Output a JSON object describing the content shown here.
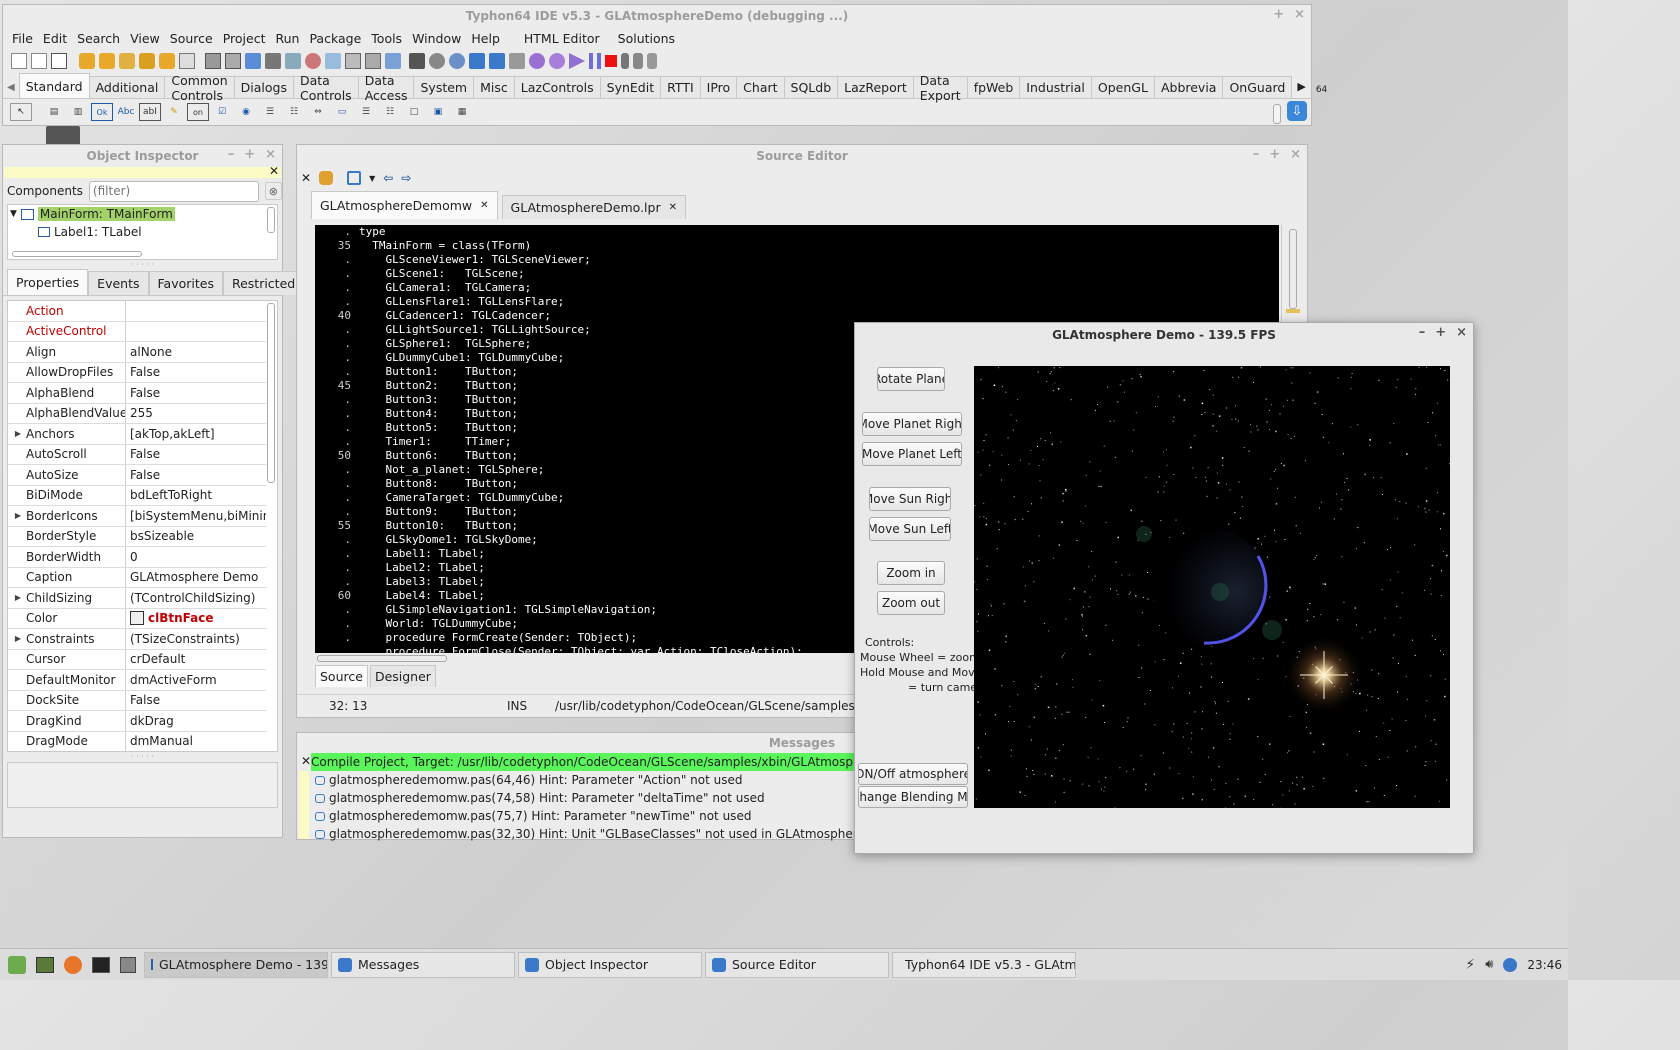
{
  "ide": {
    "title": "Typhon64 IDE v5.3 - GLAtmosphereDemo (debugging ...)",
    "menu": [
      "File",
      "Edit",
      "Search",
      "View",
      "Source",
      "Project",
      "Run",
      "Package",
      "Tools",
      "Window",
      "Help",
      "HTML Editor",
      "Solutions"
    ],
    "palette_tabs": [
      "Standard",
      "Additional",
      "Common Controls",
      "Dialogs",
      "Data Controls",
      "Data Access",
      "System",
      "Misc",
      "LazControls",
      "SynEdit",
      "RTTI",
      "IPro",
      "Chart",
      "SQLdb",
      "LazReport",
      "Data Export",
      "fpWeb",
      "Industrial",
      "OpenGL",
      "Abbrevia",
      "OnGuard"
    ],
    "bitness": "64",
    "component_glyphs": [
      "Ok",
      "Abc",
      "abI",
      "on"
    ]
  },
  "object_inspector": {
    "title": "Object Inspector",
    "components_label": "Components",
    "filter_placeholder": "(filter)",
    "tree": [
      "MainForm: TMainForm",
      "Label1: TLabel"
    ],
    "tabs": [
      "Properties",
      "Events",
      "Favorites",
      "Restricted"
    ],
    "properties": [
      {
        "name": "Action",
        "value": "",
        "highlight": true
      },
      {
        "name": "ActiveControl",
        "value": "",
        "highlight": true
      },
      {
        "name": "Align",
        "value": "alNone"
      },
      {
        "name": "AllowDropFiles",
        "value": "False"
      },
      {
        "name": "AlphaBlend",
        "value": "False"
      },
      {
        "name": "AlphaBlendValue",
        "value": "255"
      },
      {
        "name": "Anchors",
        "value": "[akTop,akLeft]",
        "expandable": true
      },
      {
        "name": "AutoScroll",
        "value": "False"
      },
      {
        "name": "AutoSize",
        "value": "False"
      },
      {
        "name": "BiDiMode",
        "value": "bdLeftToRight"
      },
      {
        "name": "BorderIcons",
        "value": "[biSystemMenu,biMinim",
        "expandable": true
      },
      {
        "name": "BorderStyle",
        "value": "bsSizeable"
      },
      {
        "name": "BorderWidth",
        "value": "0"
      },
      {
        "name": "Caption",
        "value": "GLAtmosphere Demo"
      },
      {
        "name": "ChildSizing",
        "value": "(TControlChildSizing)",
        "expandable": true
      },
      {
        "name": "Color",
        "value": "clBtnFace",
        "color": true
      },
      {
        "name": "Constraints",
        "value": "(TSizeConstraints)",
        "expandable": true
      },
      {
        "name": "Cursor",
        "value": "crDefault"
      },
      {
        "name": "DefaultMonitor",
        "value": "dmActiveForm"
      },
      {
        "name": "DockSite",
        "value": "False"
      },
      {
        "name": "DragKind",
        "value": "dkDrag"
      },
      {
        "name": "DragMode",
        "value": "dmManual"
      }
    ]
  },
  "source_editor": {
    "title": "Source Editor",
    "tabs": [
      "GLAtmosphereDemomw",
      "GLAtmosphereDemo.lpr"
    ],
    "lines": [
      {
        "no": ".",
        "text": "type"
      },
      {
        "no": "35",
        "text": "  TMainForm = class(TForm)"
      },
      {
        "no": ".",
        "text": "    GLSceneViewer1: TGLSceneViewer;"
      },
      {
        "no": ".",
        "text": "    GLScene1:   TGLScene;"
      },
      {
        "no": ".",
        "text": "    GLCamera1:  TGLCamera;"
      },
      {
        "no": ".",
        "text": "    GLLensFlare1: TGLLensFlare;"
      },
      {
        "no": "40",
        "text": "    GLCadencer1: TGLCadencer;"
      },
      {
        "no": ".",
        "text": "    GLLightSource1: TGLLightSource;"
      },
      {
        "no": ".",
        "text": "    GLSphere1:  TGLSphere;"
      },
      {
        "no": ".",
        "text": "    GLDummyCube1: TGLDummyCube;"
      },
      {
        "no": ".",
        "text": "    Button1:    TButton;"
      },
      {
        "no": "45",
        "text": "    Button2:    TButton;"
      },
      {
        "no": ".",
        "text": "    Button3:    TButton;"
      },
      {
        "no": ".",
        "text": "    Button4:    TButton;"
      },
      {
        "no": ".",
        "text": "    Button5:    TButton;"
      },
      {
        "no": ".",
        "text": "    Timer1:     TTimer;"
      },
      {
        "no": "50",
        "text": "    Button6:    TButton;"
      },
      {
        "no": ".",
        "text": "    Not_a_planet: TGLSphere;"
      },
      {
        "no": ".",
        "text": "    Button8:    TButton;"
      },
      {
        "no": ".",
        "text": "    CameraTarget: TGLDummyCube;"
      },
      {
        "no": ".",
        "text": "    Button9:    TButton;"
      },
      {
        "no": "55",
        "text": "    Button10:   TButton;"
      },
      {
        "no": ".",
        "text": "    GLSkyDome1: TGLSkyDome;"
      },
      {
        "no": ".",
        "text": "    Label1: TLabel;"
      },
      {
        "no": ".",
        "text": "    Label2: TLabel;"
      },
      {
        "no": ".",
        "text": "    Label3: TLabel;"
      },
      {
        "no": "60",
        "text": "    Label4: TLabel;"
      },
      {
        "no": ".",
        "text": "    GLSimpleNavigation1: TGLSimpleNavigation;"
      },
      {
        "no": ".",
        "text": "    World: TGLDummyCube;"
      },
      {
        "no": ".",
        "text": "    procedure FormCreate(Sender: TObject);"
      },
      {
        "no": ".",
        "text": "    procedure FormClose(Sender: TObject; var Action: TCloseAction);"
      }
    ],
    "bottom_tabs": [
      "Source",
      "Designer"
    ],
    "status_pos": "32: 13",
    "status_mode": "INS",
    "status_path": "/usr/lib/codetyphon/CodeOcean/GLScene/samples"
  },
  "messages": {
    "title": "Messages",
    "compile": "Compile Project, Target: /usr/lib/codetyphon/CodeOcean/GLScene/samples/xbin/GLAtmosphereDemo: Su",
    "hints": [
      "glatmospheredemomw.pas(64,46) Hint: Parameter \"Action\" not used",
      "glatmospheredemomw.pas(74,58) Hint: Parameter \"deltaTime\" not used",
      "glatmospheredemomw.pas(75,7) Hint: Parameter \"newTime\" not used",
      "glatmospheredemomw.pas(32,30) Hint: Unit \"GLBaseClasses\" not used in GLAtmosphereDemomw"
    ]
  },
  "demo": {
    "title": "GLAtmosphere Demo - 139.5 FPS",
    "buttons": {
      "rotate": "Rotate Plane",
      "planet_right": "Move Planet Right",
      "planet_left": "Move Planet Left",
      "sun_right": "Move Sun Right",
      "sun_left": "Move Sun Left",
      "zoom_in": "Zoom in",
      "zoom_out": "Zoom out",
      "atmosphere": "ON/Off atmosphere",
      "blending": "Change Blending Mo"
    },
    "controls_text": [
      "Controls:",
      "Mouse Wheel = zoom",
      "Hold Mouse and Move",
      "= turn came"
    ]
  },
  "taskbar": {
    "tasks": [
      "GLAtmosphere Demo - 139....",
      "Messages",
      "Object Inspector",
      "Source Editor",
      "Typhon64 IDE v5.3 - GLAtmo..."
    ],
    "clock": "23:46"
  }
}
